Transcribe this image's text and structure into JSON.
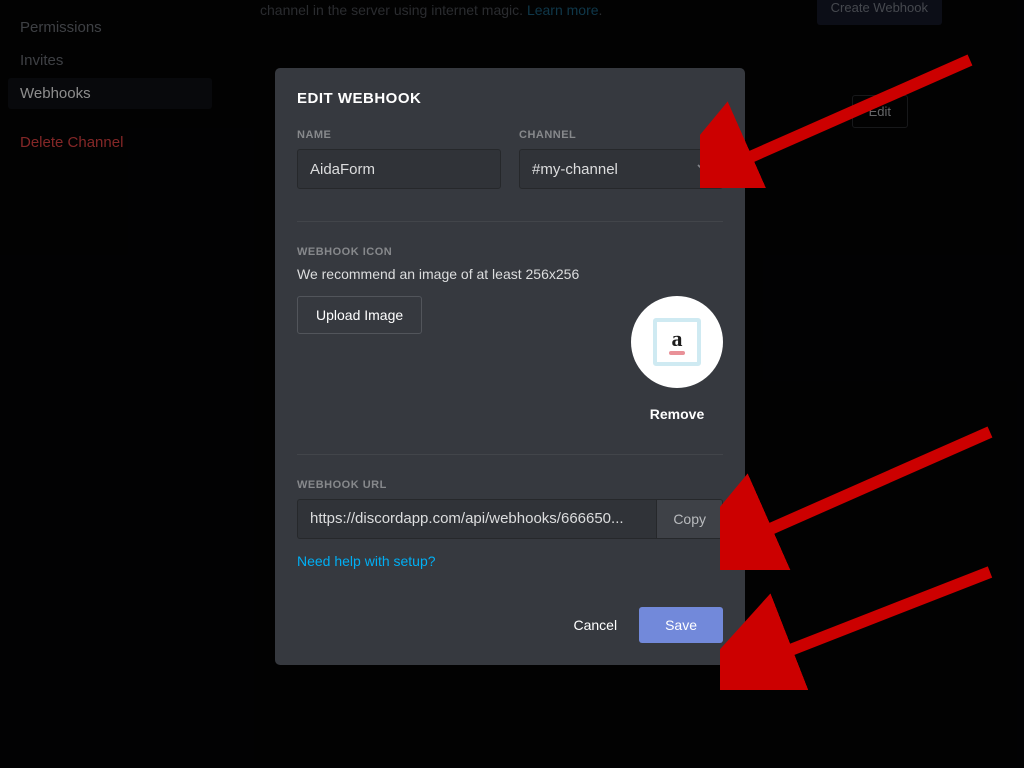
{
  "sidebar": {
    "items": [
      {
        "label": "Permissions",
        "selected": false
      },
      {
        "label": "Invites",
        "selected": false
      },
      {
        "label": "Webhooks",
        "selected": true
      }
    ],
    "delete_label": "Delete Channel"
  },
  "background": {
    "blurb_prefix": "channel in the server using internet magic. ",
    "learn_more": "Learn more",
    "create_webhook": "Create Webhook",
    "edit": "Edit"
  },
  "modal": {
    "title": "EDIT WEBHOOK",
    "name_label": "NAME",
    "name_value": "AidaForm",
    "channel_label": "CHANNEL",
    "channel_value": "#my-channel",
    "icon_label": "WEBHOOK ICON",
    "icon_hint": "We recommend an image of at least 256x256",
    "upload_label": "Upload Image",
    "remove_label": "Remove",
    "url_label": "WEBHOOK URL",
    "url_value": "https://discordapp.com/api/webhooks/666650...",
    "copy_label": "Copy",
    "help_label": "Need help with setup?",
    "cancel_label": "Cancel",
    "save_label": "Save"
  }
}
